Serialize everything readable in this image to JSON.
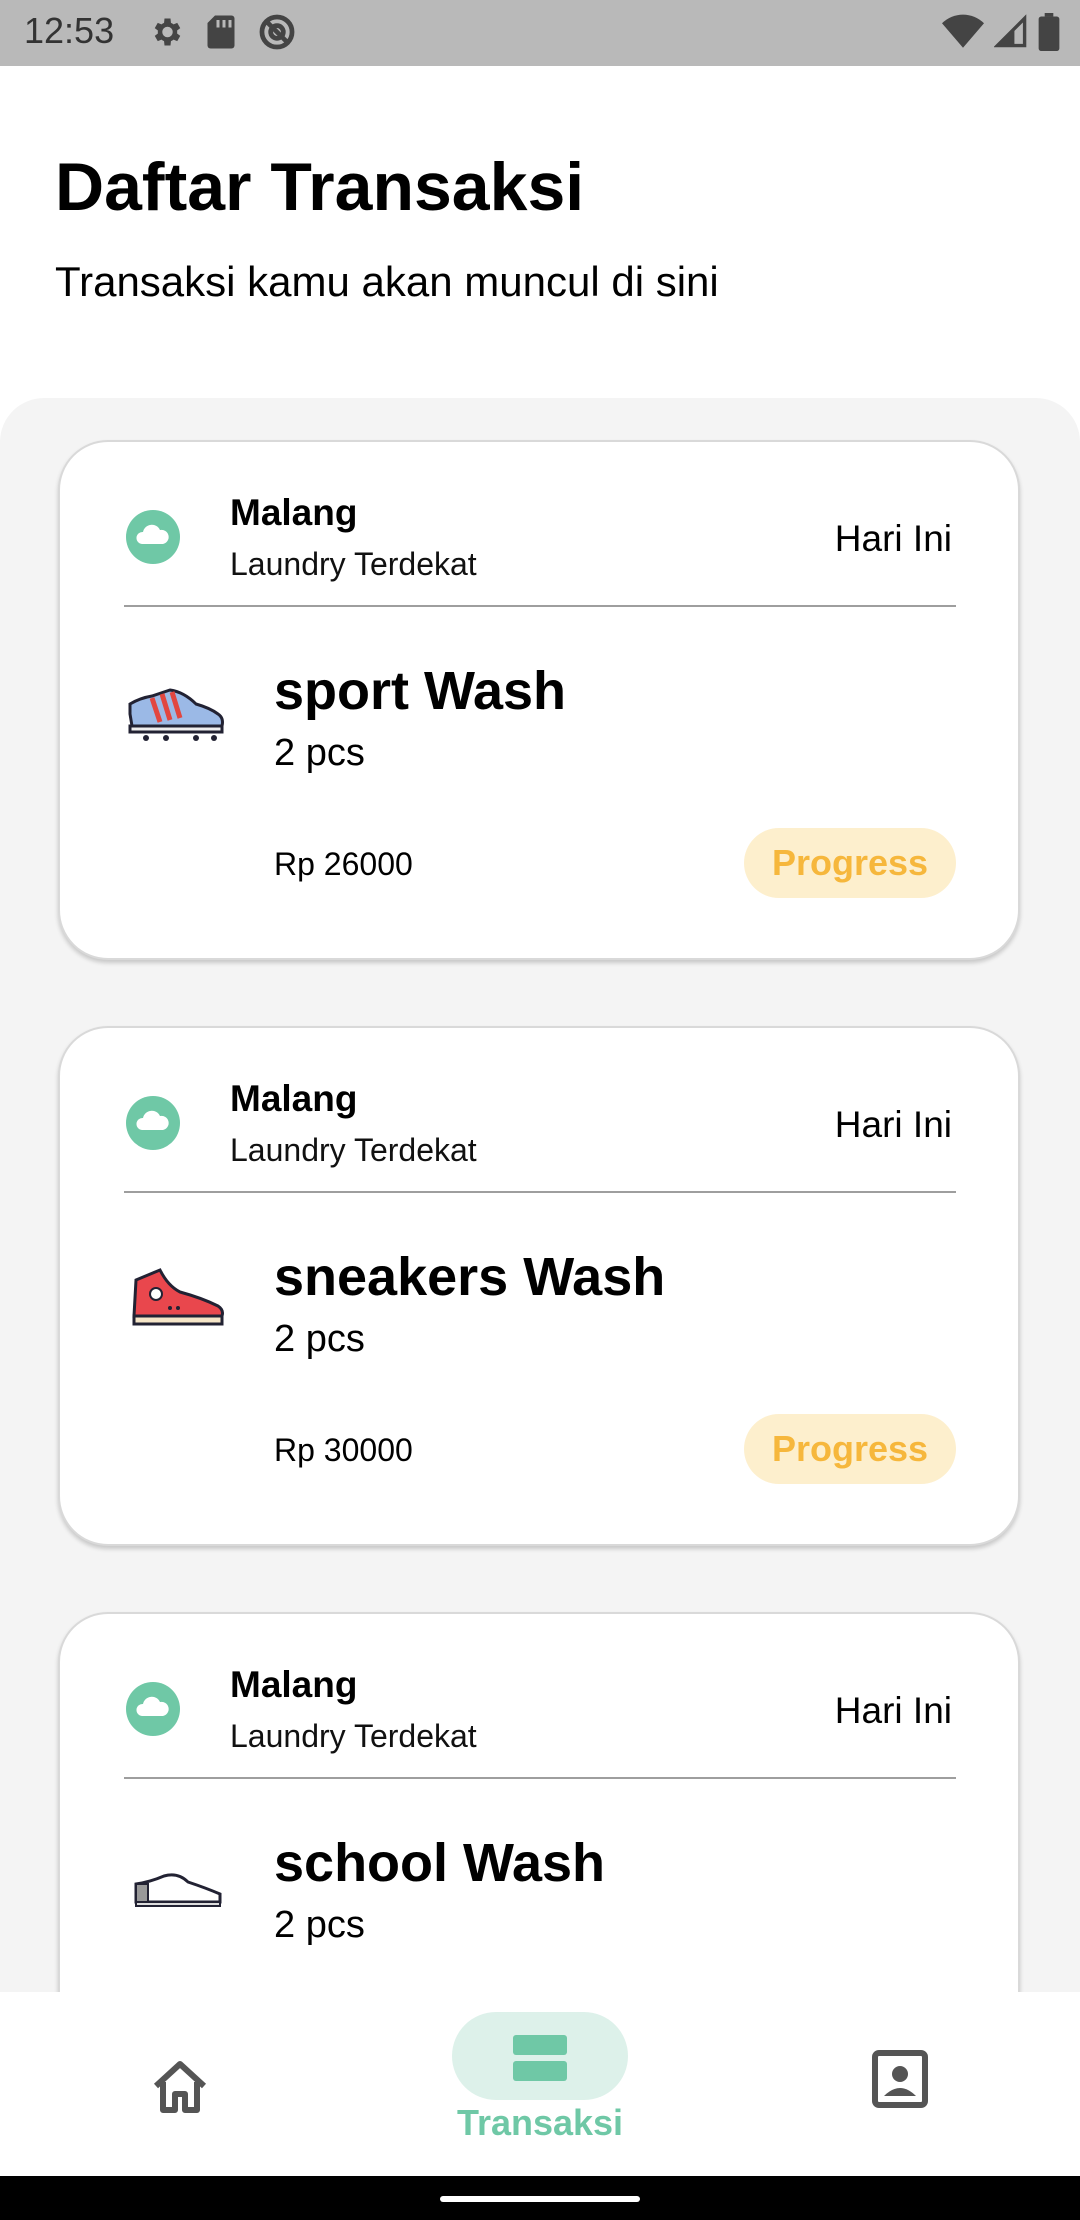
{
  "status_bar": {
    "time": "12:53",
    "left_icons": [
      "settings-icon",
      "sd-card-icon",
      "at-sign-icon"
    ],
    "right_icons": [
      "wifi-icon",
      "signal-icon",
      "battery-icon"
    ]
  },
  "header": {
    "title": "Daftar Transaksi",
    "subtitle": "Transaksi kamu akan muncul di sini"
  },
  "transactions": [
    {
      "city": "Malang",
      "store": "Laundry Terdekat",
      "date": "Hari Ini",
      "item_name": "sport Wash",
      "quantity": "2 pcs",
      "price": "Rp 26000",
      "status": "Progress",
      "icon": "sport-shoe-icon"
    },
    {
      "city": "Malang",
      "store": "Laundry Terdekat",
      "date": "Hari Ini",
      "item_name": "sneakers Wash",
      "quantity": "2 pcs",
      "price": "Rp 30000",
      "status": "Progress",
      "icon": "sneaker-shoe-icon"
    },
    {
      "city": "Malang",
      "store": "Laundry Terdekat",
      "date": "Hari Ini",
      "item_name": "school Wash",
      "quantity": "2 pcs",
      "icon": "school-shoe-icon"
    }
  ],
  "bottom_nav": {
    "items": [
      {
        "icon": "home-icon",
        "active": false
      },
      {
        "icon": "transactions-icon",
        "label": "Transaksi",
        "active": true
      },
      {
        "icon": "profile-icon",
        "active": false
      }
    ]
  },
  "colors": {
    "accent": "#6fc8a6",
    "status_text": "#f6b73c",
    "status_bg": "#fdefcd",
    "panel_bg": "#f4f4f4"
  }
}
